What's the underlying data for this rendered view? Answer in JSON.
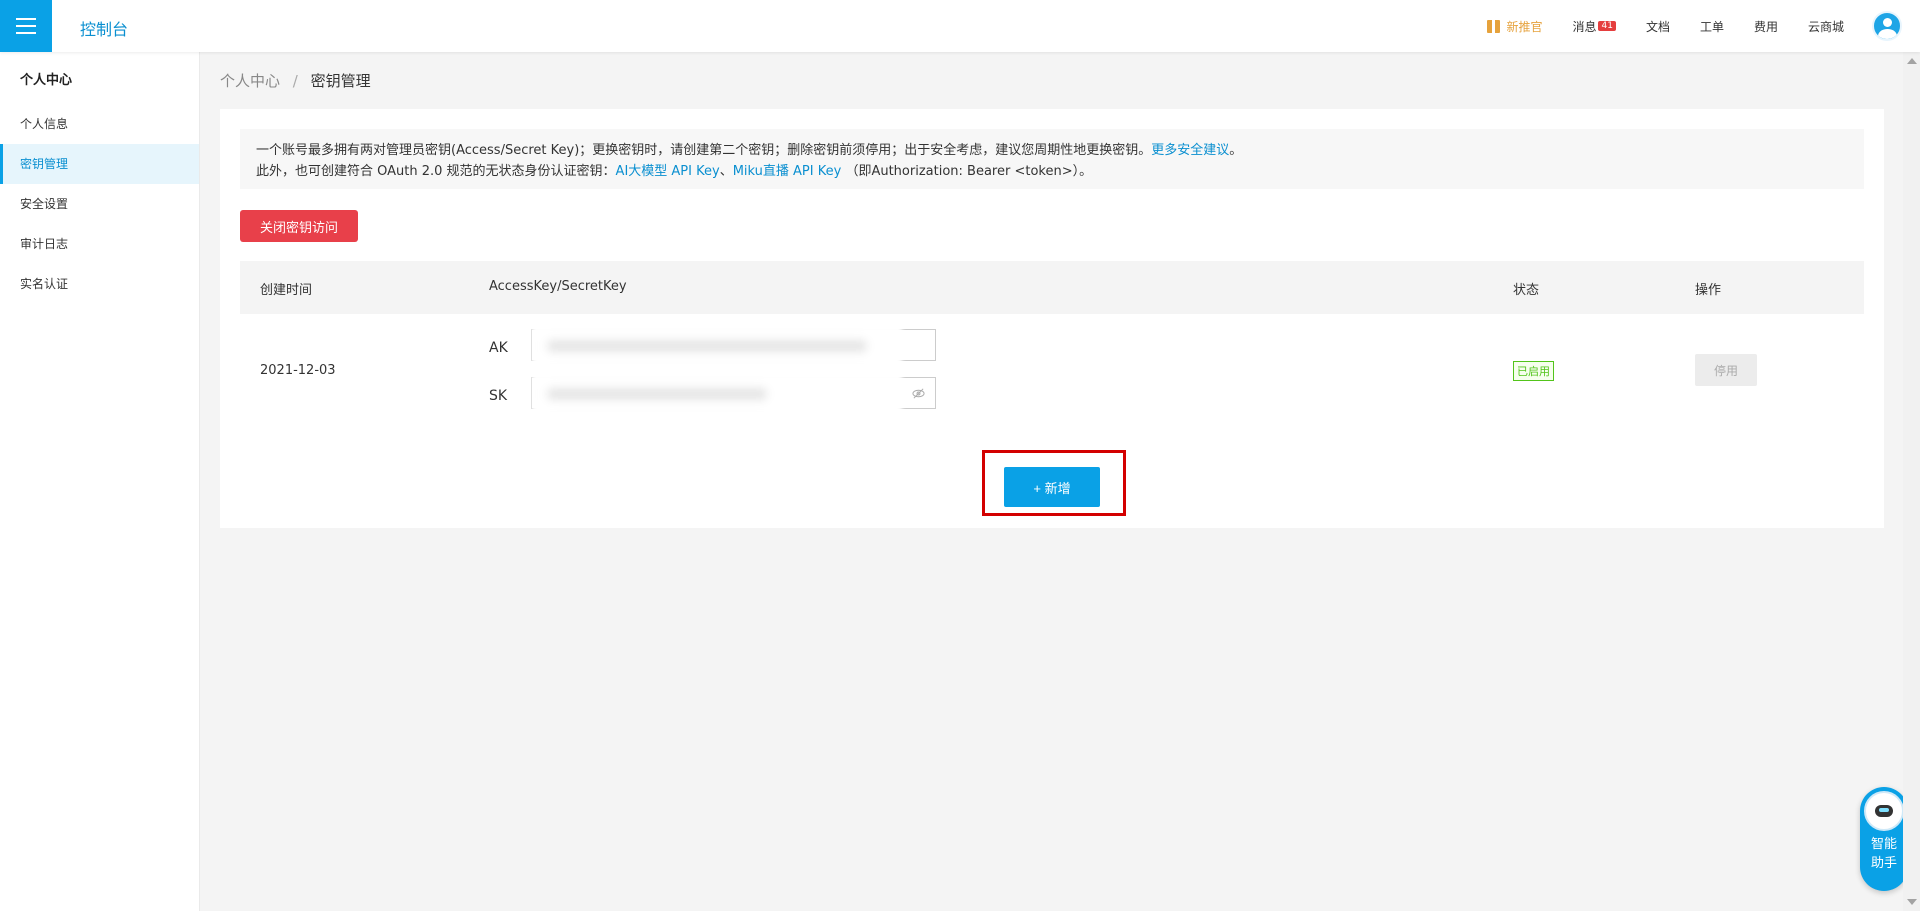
{
  "header": {
    "brand": "控制台",
    "nav": {
      "promo": "新推官",
      "messages": "消息",
      "messages_badge": "41",
      "docs": "文档",
      "tickets": "工单",
      "billing": "费用",
      "store": "云商城"
    }
  },
  "sidebar": {
    "title": "个人中心",
    "items": [
      {
        "label": "个人信息"
      },
      {
        "label": "密钥管理"
      },
      {
        "label": "安全设置"
      },
      {
        "label": "审计日志"
      },
      {
        "label": "实名认证"
      }
    ]
  },
  "breadcrumb": {
    "parent": "个人中心",
    "separator": "/",
    "current": "密钥管理"
  },
  "notice": {
    "line1_text": "一个账号最多拥有两对管理员密钥(Access/Secret Key)；更换密钥时，请创建第二个密钥；删除密钥前须停用；出于安全考虑，建议您周期性地更换密钥。",
    "line1_link": "更多安全建议",
    "line1_end": "。",
    "line2_text": "此外，也可创建符合 OAuth 2.0 规范的无状态身份认证密钥：",
    "line2_link1": "AI大模型 API Key",
    "line2_sep": "、",
    "line2_link2": "Miku直播 API Key",
    "line2_end": "（即Authorization: Bearer <token>）。"
  },
  "actions": {
    "close_access": "关闭密钥访问",
    "add": "+ 新增"
  },
  "table": {
    "columns": [
      "创建时间",
      "AccessKey/SecretKey",
      "状态",
      "操作"
    ],
    "rows": [
      {
        "created": "2021-12-03",
        "ak_label": "AK",
        "sk_label": "SK",
        "status": "已启用",
        "action": "停用"
      }
    ]
  },
  "assistant": {
    "label_line1": "智能",
    "label_line2": "助手"
  },
  "colors": {
    "primary": "#0aa1e6",
    "danger": "#e8404a",
    "success": "#52c41a",
    "highlight_border": "#d30000"
  }
}
